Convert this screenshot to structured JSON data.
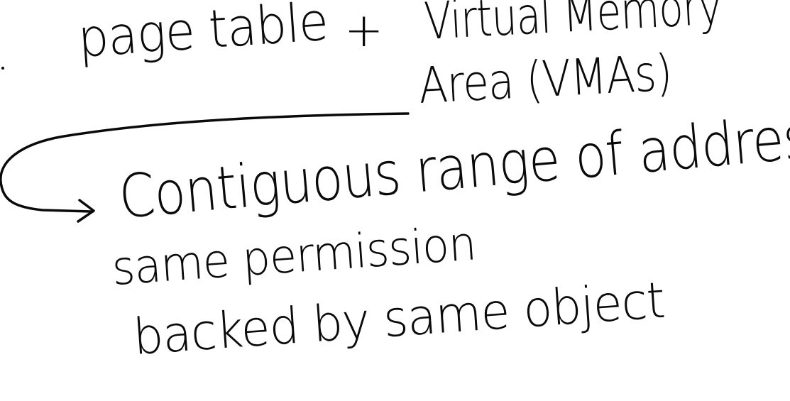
{
  "note": {
    "title_left": "page table",
    "plus": "+",
    "title_right_line1": "Virtual Memory",
    "title_right_line2": "Area (VMAs)",
    "line1": "Contiguous range of addresses",
    "line2": "same permission",
    "line3": "backed by same object"
  },
  "colors": {
    "ink": "#0a0a0a",
    "background": "#ffffff"
  }
}
